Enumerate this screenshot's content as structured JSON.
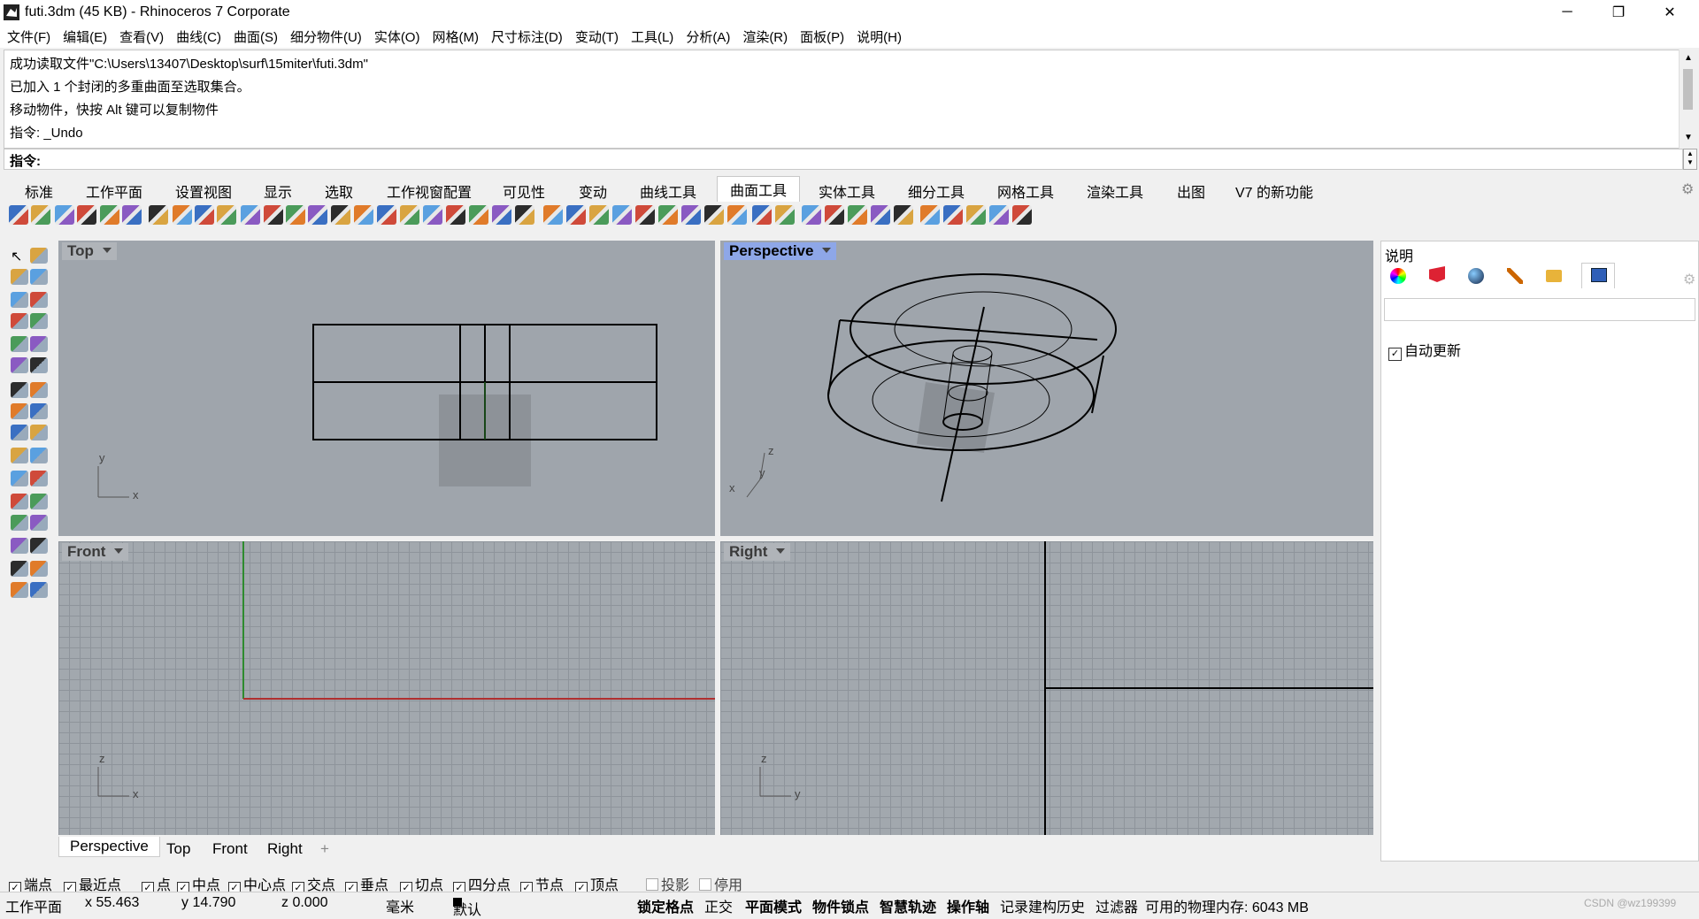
{
  "window": {
    "title": "futi.3dm (45 KB) - Rhinoceros 7 Corporate",
    "min": "─",
    "max": "❐",
    "close": "✕"
  },
  "menu": [
    "文件(F)",
    "编辑(E)",
    "查看(V)",
    "曲线(C)",
    "曲面(S)",
    "细分物件(U)",
    "实体(O)",
    "网格(M)",
    "尺寸标注(D)",
    "变动(T)",
    "工具(L)",
    "分析(A)",
    "渲染(R)",
    "面板(P)",
    "说明(H)"
  ],
  "command_history": [
    "成功读取文件\"C:\\Users\\13407\\Desktop\\surf\\15miter\\futi.3dm\"",
    "已加入 1 个封闭的多重曲面至选取集合。",
    "移动物件，快按 Alt 键可以复制物件",
    "指令: _Undo"
  ],
  "command_prompt": "指令:",
  "toolbar_tabs": [
    "标准",
    "工作平面",
    "设置视图",
    "显示",
    "选取",
    "工作视窗配置",
    "可见性",
    "变动",
    "曲线工具",
    "曲面工具",
    "实体工具",
    "细分工具",
    "网格工具",
    "渲染工具",
    "出图",
    "V7 的新功能"
  ],
  "active_toolbar_tab": "曲面工具",
  "viewports": {
    "top": {
      "label": "Top",
      "axis1": "y",
      "axis2": "x"
    },
    "perspective": {
      "label": "Perspective",
      "axis1": "z",
      "axis2": "y",
      "axis3": "x"
    },
    "front": {
      "label": "Front",
      "axis1": "z",
      "axis2": "x"
    },
    "right": {
      "label": "Right",
      "axis1": "z",
      "axis2": "y"
    }
  },
  "viewport_tabs": [
    "Perspective",
    "Top",
    "Front",
    "Right"
  ],
  "viewport_tab_add": "+",
  "osnaps": [
    {
      "label": "端点",
      "checked": true
    },
    {
      "label": "最近点",
      "checked": true
    },
    {
      "label": "点",
      "checked": true
    },
    {
      "label": "中点",
      "checked": true
    },
    {
      "label": "中心点",
      "checked": true
    },
    {
      "label": "交点",
      "checked": true
    },
    {
      "label": "垂点",
      "checked": true
    },
    {
      "label": "切点",
      "checked": true
    },
    {
      "label": "四分点",
      "checked": true
    },
    {
      "label": "节点",
      "checked": true
    },
    {
      "label": "顶点",
      "checked": true
    },
    {
      "label": "投影",
      "checked": false
    },
    {
      "label": "停用",
      "checked": false
    }
  ],
  "status": {
    "cplane": "工作平面",
    "x": "x 55.463",
    "y": "y 14.790",
    "z": "z 0.000",
    "units": "毫米",
    "layer": "默认",
    "grid_snap": "锁定格点",
    "ortho": "正交",
    "planar": "平面模式",
    "osnap": "物件锁点",
    "smarttrack": "智慧轨迹",
    "gumball": "操作轴",
    "history": "记录建构历史",
    "filter": "过滤器",
    "memory": "可用的物理内存: 6043 MB"
  },
  "panel": {
    "title": "说明",
    "auto_update_label": "自动更新",
    "auto_update_checked": true
  },
  "watermark": "CSDN @wz199399",
  "colors": {
    "viewport_bg": "#9fa5ac",
    "active_label": "#8ea7e8",
    "x_axis": "#b03030",
    "y_axis": "#2e8b2e"
  }
}
